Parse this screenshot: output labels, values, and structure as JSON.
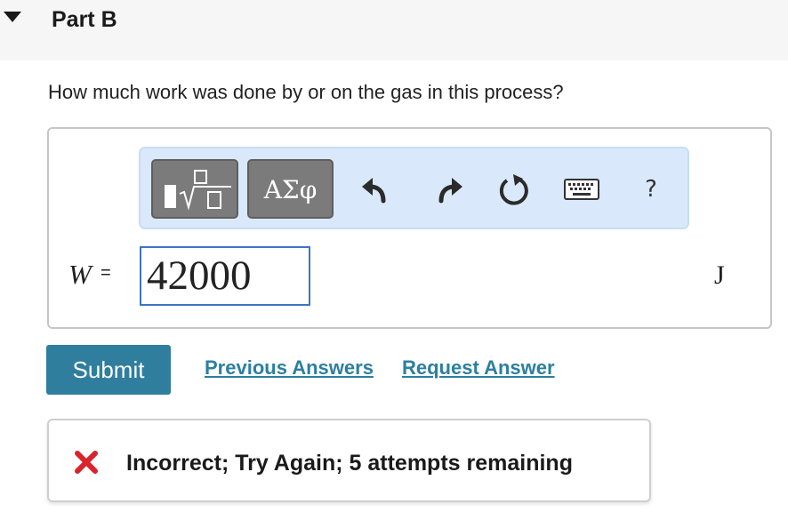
{
  "part": {
    "title": "Part B"
  },
  "question": {
    "text": "How much work was done by or on the gas in this process?"
  },
  "toolbar": {
    "template_icon": "templates-icon",
    "greek_label": "ΑΣφ",
    "undo_icon": "undo-icon",
    "redo_icon": "redo-icon",
    "reset_icon": "reset-icon",
    "keyboard_icon": "keyboard-icon",
    "help_label": "?"
  },
  "answer": {
    "variable": "W",
    "equals": "=",
    "value": "42000",
    "unit": "J"
  },
  "actions": {
    "submit_label": "Submit",
    "previous_answers_label": "Previous Answers",
    "request_answer_label": "Request Answer"
  },
  "feedback": {
    "icon": "x-icon",
    "text": "Incorrect; Try Again; 5 attempts remaining"
  },
  "colors": {
    "submit_bg": "#2f7e9e",
    "link": "#2c7fa0",
    "toolbar_bg": "#d9e9fb",
    "input_border": "#3b74c7",
    "error_red": "#d9232d"
  }
}
